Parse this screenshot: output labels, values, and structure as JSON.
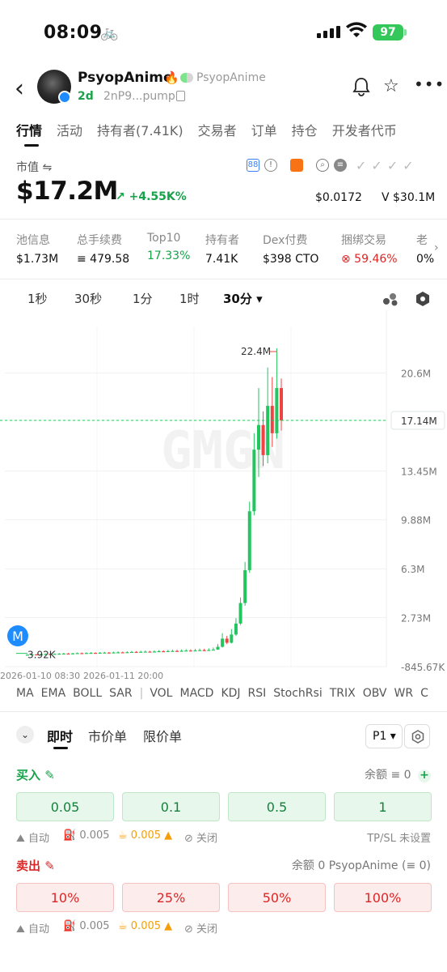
{
  "status": {
    "time": "08:09",
    "battery": "97"
  },
  "token": {
    "name": "PsyopAnime",
    "handle": "PsyopAnime",
    "age": "2d",
    "address": "2nP9...pump"
  },
  "tabs": [
    "行情",
    "活动",
    "持有者(7.41K)",
    "交易者",
    "订单",
    "持仓",
    "开发者代币"
  ],
  "market": {
    "label": "市值 ⇋",
    "value": "$17.2M",
    "change": "↗ +4.55K%",
    "price": "$0.0172",
    "volume": "V $30.1M"
  },
  "stats": [
    {
      "label": "池信息",
      "value": "$1.73M"
    },
    {
      "label": "总手续费",
      "value": "≡ 479.58"
    },
    {
      "label": "Top10",
      "value": "17.33%"
    },
    {
      "label": "持有者",
      "value": "7.41K"
    },
    {
      "label": "Dex付费",
      "value": "$398 CTO"
    },
    {
      "label": "捆绑交易",
      "value": "⊗ 59.46%"
    },
    {
      "label": "老",
      "value": "0%"
    }
  ],
  "intervals": [
    "1秒",
    "30秒",
    "1分",
    "1时",
    "30分 ▾"
  ],
  "chart_data": {
    "type": "candlestick",
    "watermark": "GMGN",
    "y_ticks": [
      "20.6M",
      "17.14M",
      "13.45M",
      "9.88M",
      "6.3M",
      "2.73M",
      "-845.67K"
    ],
    "y_values": [
      20.6,
      17.14,
      13.45,
      9.88,
      6.3,
      2.73,
      -0.84567
    ],
    "y_unit": "M",
    "ylim": [
      -0.84567,
      24.0
    ],
    "current_label": "17.14M",
    "current_value": 17.14,
    "high_label": "22.4M",
    "high_value": 22.4,
    "low_label": "3.92K",
    "low_value": 0.00392,
    "x_ticks": [
      "2026-01-10 08:30",
      "2026-01-11 20:00"
    ],
    "marker": "M",
    "candles": [
      [
        0.0039,
        0.03,
        0.05,
        0.0
      ],
      [
        0.03,
        0.05,
        0.08,
        0.02
      ],
      [
        0.05,
        0.04,
        0.07,
        0.03
      ],
      [
        0.04,
        0.06,
        0.09,
        0.03
      ],
      [
        0.06,
        0.08,
        0.11,
        0.05
      ],
      [
        0.08,
        0.07,
        0.1,
        0.05
      ],
      [
        0.07,
        0.09,
        0.12,
        0.06
      ],
      [
        0.09,
        0.1,
        0.14,
        0.08
      ],
      [
        0.1,
        0.11,
        0.16,
        0.09
      ],
      [
        0.11,
        0.1,
        0.15,
        0.08
      ],
      [
        0.1,
        0.12,
        0.16,
        0.09
      ],
      [
        0.12,
        0.14,
        0.19,
        0.11
      ],
      [
        0.14,
        0.13,
        0.18,
        0.11
      ],
      [
        0.13,
        0.15,
        0.2,
        0.12
      ],
      [
        0.15,
        0.16,
        0.21,
        0.13
      ],
      [
        0.16,
        0.15,
        0.2,
        0.13
      ],
      [
        0.15,
        0.17,
        0.22,
        0.14
      ],
      [
        0.17,
        0.18,
        0.24,
        0.15
      ],
      [
        0.18,
        0.17,
        0.22,
        0.15
      ],
      [
        0.17,
        0.19,
        0.25,
        0.16
      ],
      [
        0.19,
        0.2,
        0.27,
        0.17
      ],
      [
        0.2,
        0.19,
        0.25,
        0.17
      ],
      [
        0.19,
        0.21,
        0.28,
        0.18
      ],
      [
        0.21,
        0.23,
        0.3,
        0.2
      ],
      [
        0.23,
        0.22,
        0.29,
        0.2
      ],
      [
        0.22,
        0.24,
        0.31,
        0.21
      ],
      [
        0.24,
        0.25,
        0.33,
        0.22
      ],
      [
        0.25,
        0.24,
        0.31,
        0.22
      ],
      [
        0.24,
        0.26,
        0.34,
        0.23
      ],
      [
        0.26,
        0.28,
        0.36,
        0.25
      ],
      [
        0.28,
        0.27,
        0.35,
        0.25
      ],
      [
        0.27,
        0.29,
        0.38,
        0.26
      ],
      [
        0.29,
        0.3,
        0.4,
        0.27
      ],
      [
        0.3,
        0.29,
        0.38,
        0.27
      ],
      [
        0.29,
        0.31,
        0.41,
        0.28
      ],
      [
        0.31,
        0.33,
        0.43,
        0.3
      ],
      [
        0.33,
        0.32,
        0.42,
        0.3
      ],
      [
        0.32,
        0.34,
        0.45,
        0.31
      ],
      [
        0.34,
        0.36,
        0.47,
        0.33
      ],
      [
        0.36,
        0.35,
        0.46,
        0.33
      ],
      [
        0.35,
        0.37,
        0.49,
        0.34
      ],
      [
        0.37,
        0.4,
        0.55,
        0.35
      ],
      [
        0.4,
        0.6,
        0.8,
        0.38
      ],
      [
        0.6,
        1.2,
        1.6,
        0.55
      ],
      [
        1.2,
        0.9,
        1.4,
        0.8
      ],
      [
        0.9,
        1.5,
        1.9,
        0.85
      ],
      [
        1.5,
        2.3,
        2.7,
        1.4
      ],
      [
        2.3,
        3.8,
        4.2,
        2.2
      ],
      [
        3.8,
        6.2,
        6.8,
        3.6
      ],
      [
        6.2,
        10.5,
        11.2,
        6.0
      ],
      [
        10.5,
        15.0,
        16.2,
        10.2
      ],
      [
        15.0,
        16.8,
        19.5,
        13.0
      ],
      [
        16.8,
        14.6,
        17.8,
        13.8
      ],
      [
        14.6,
        18.2,
        21.0,
        14.0
      ],
      [
        18.2,
        16.2,
        20.3,
        15.2
      ],
      [
        16.2,
        19.5,
        22.4,
        15.8
      ],
      [
        19.5,
        17.14,
        20.2,
        16.4
      ]
    ]
  },
  "indicators": [
    "MA",
    "EMA",
    "BOLL",
    "SAR",
    "|",
    "VOL",
    "MACD",
    "KDJ",
    "RSI",
    "StochRsi",
    "TRIX",
    "OBV",
    "WR",
    "C"
  ],
  "order": {
    "tabs": [
      "即时",
      "市价单",
      "限价单"
    ],
    "preset": "P1 ▾",
    "buy": {
      "label": "买入 ✎",
      "balance": "余额 ≡ 0",
      "amounts": [
        "0.05",
        "0.1",
        "0.5",
        "1"
      ],
      "options": [
        "⛰ 自动",
        "⛽ 0.005",
        "☕ 0.005 ▲",
        "⊘ 关闭"
      ],
      "tpsl": "TP/SL 未设置"
    },
    "sell": {
      "label": "卖出 ✎",
      "balance": "余额 0 PsyopAnime (≡ 0)",
      "amounts": [
        "10%",
        "25%",
        "50%",
        "100%"
      ],
      "options": [
        "⛰ 自动",
        "⛽ 0.005",
        "☕ 0.005 ▲",
        "⊘ 关闭"
      ]
    }
  }
}
